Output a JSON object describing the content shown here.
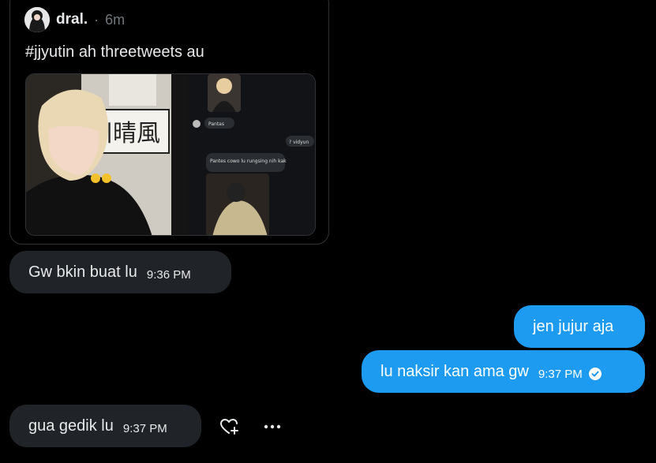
{
  "tweet": {
    "author": "dral.",
    "separator": "·",
    "time": "6m",
    "text": "#jjyutin ah threetweets au",
    "media": {
      "left_image": "person-with-blonde-hair-photo",
      "right_image": "chat-screenshot",
      "chat_snippets": [
        "Pantas",
        "? vidyun",
        "Pantes cowo lu rungsing nih kak"
      ]
    }
  },
  "messages": [
    {
      "direction": "received",
      "text": "Gw bkin buat lu",
      "time": "9:36 PM"
    },
    {
      "direction": "sent",
      "text": "jen jujur aja",
      "time": ""
    },
    {
      "direction": "sent",
      "text": "lu naksir kan ama gw",
      "time": "9:37 PM",
      "status_icon": "check-circle-icon"
    },
    {
      "direction": "received",
      "text": "gua gedik lu",
      "time": "9:37 PM"
    }
  ],
  "colors": {
    "background": "#000000",
    "sent_bubble": "#1d9bf0",
    "received_bubble": "#202327",
    "muted": "#71767b"
  },
  "actions": {
    "react_icon": "heart-plus-icon",
    "more_icon": "more-horizontal-icon"
  }
}
